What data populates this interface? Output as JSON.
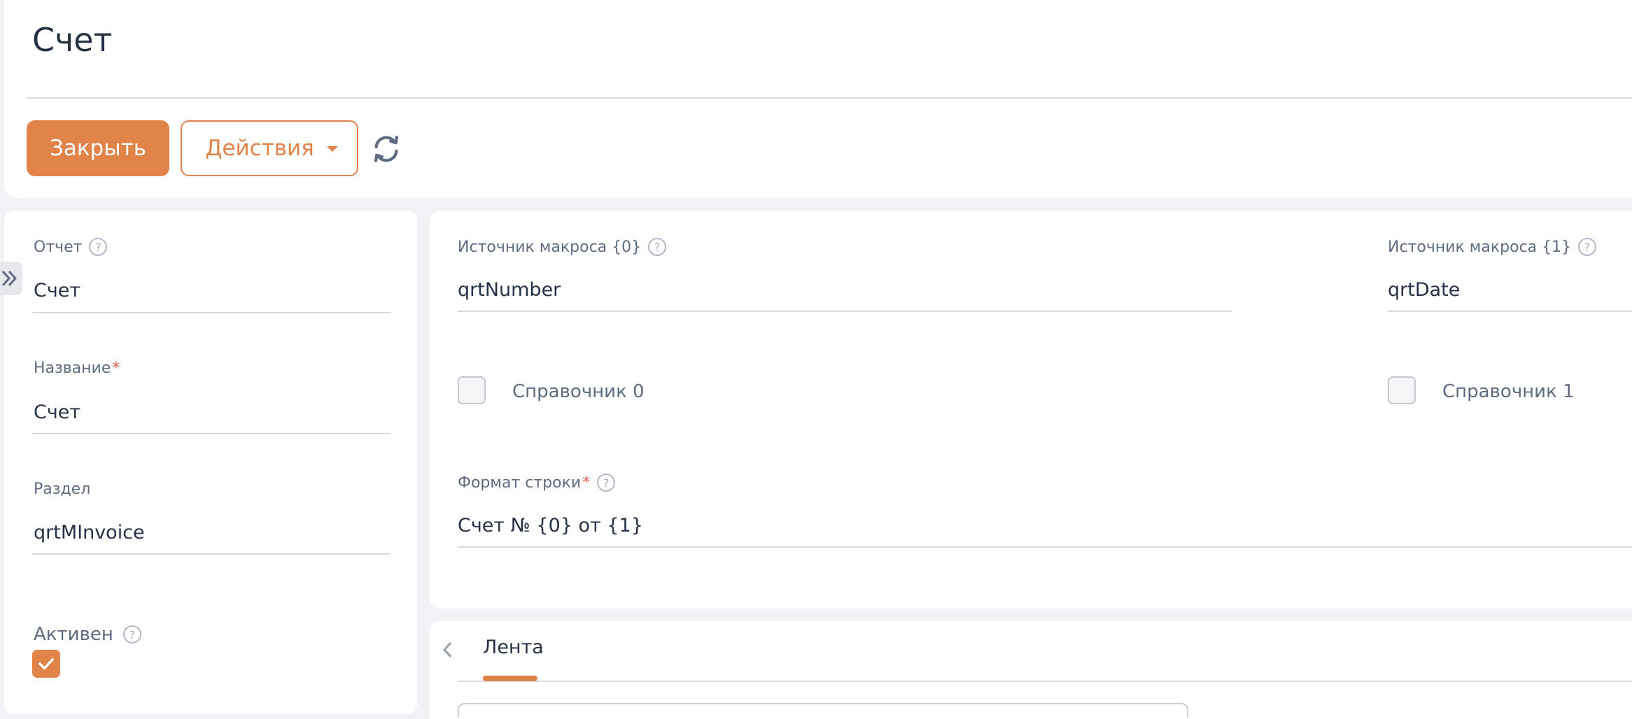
{
  "page": {
    "title": "Счет"
  },
  "toolbar": {
    "close_label": "Закрыть",
    "actions_label": "Действия"
  },
  "colors": {
    "accent": "#e0844a",
    "required": "#e0544a",
    "text": "#263145",
    "label": "#5f6b80"
  },
  "left_panel": {
    "report": {
      "label": "Отчет",
      "value": "Счет"
    },
    "name": {
      "label": "Название",
      "required_mark": "*",
      "value": "Счет"
    },
    "section": {
      "label": "Раздел",
      "value": "qrtMInvoice"
    },
    "active": {
      "label": "Активен",
      "checked": true
    }
  },
  "right_panel": {
    "macro_source_0": {
      "label": "Источник макроса {0}",
      "value": "qrtNumber"
    },
    "macro_source_1": {
      "label": "Источник макроса {1}",
      "value": "qrtDate"
    },
    "dictionary_0": {
      "label": "Справочник 0",
      "checked": false
    },
    "dictionary_1": {
      "label": "Справочник 1",
      "checked": false
    },
    "string_format": {
      "label": "Формат строки",
      "required_mark": "*",
      "value": "Счет № {0} от {1}"
    }
  },
  "tabs": [
    {
      "label": "Лента",
      "active": true
    }
  ],
  "icons": {
    "refresh": "refresh-icon",
    "help": "help-icon",
    "caret": "caret-down-icon",
    "sidebar": "double-chevron-right-icon",
    "tab_prev": "chevron-left-icon",
    "check": "check-icon"
  },
  "help_glyph": "?"
}
